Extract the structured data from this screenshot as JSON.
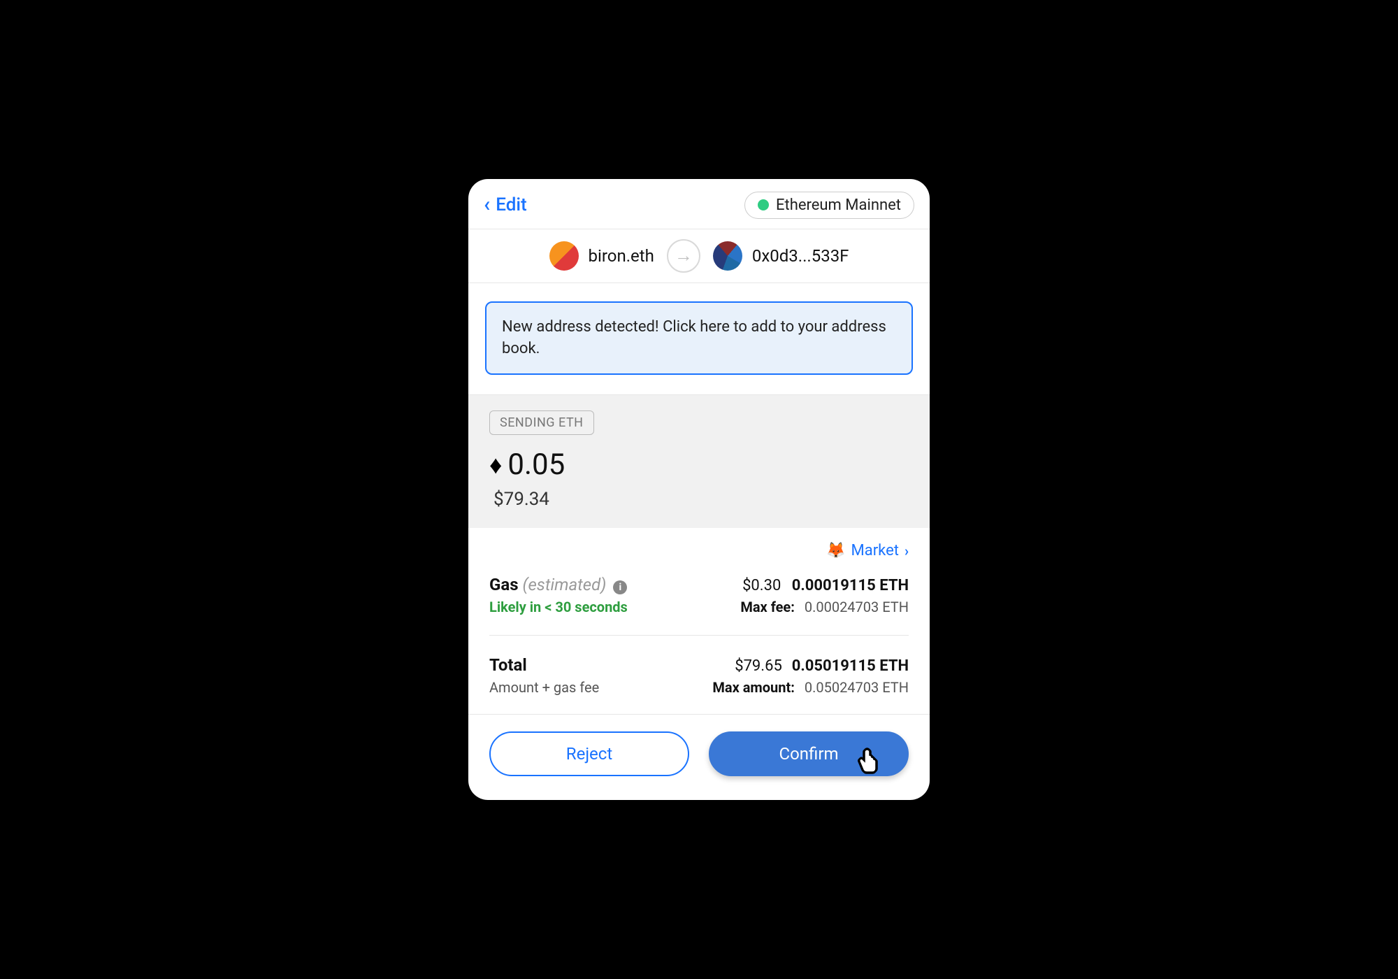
{
  "header": {
    "back_label": "Edit",
    "network": "Ethereum Mainnet"
  },
  "accounts": {
    "from": "biron.eth",
    "to": "0x0d3...533F"
  },
  "banner": {
    "text": "New address detected! Click here to add to your address book."
  },
  "amount": {
    "badge": "SENDING ETH",
    "crypto": "0.05",
    "fiat": "$79.34"
  },
  "fees": {
    "market_label": "Market",
    "gas_label": "Gas",
    "gas_sublabel": "(estimated)",
    "gas_usd": "$0.30",
    "gas_eth": "0.00019115 ETH",
    "likely_text": "Likely in < 30 seconds",
    "maxfee_label": "Max fee:",
    "maxfee_value": "0.00024703 ETH",
    "total_label": "Total",
    "total_sublabel": "Amount + gas fee",
    "total_usd": "$79.65",
    "total_eth": "0.05019115 ETH",
    "maxamount_label": "Max amount:",
    "maxamount_value": "0.05024703 ETH"
  },
  "buttons": {
    "reject": "Reject",
    "confirm": "Confirm"
  }
}
